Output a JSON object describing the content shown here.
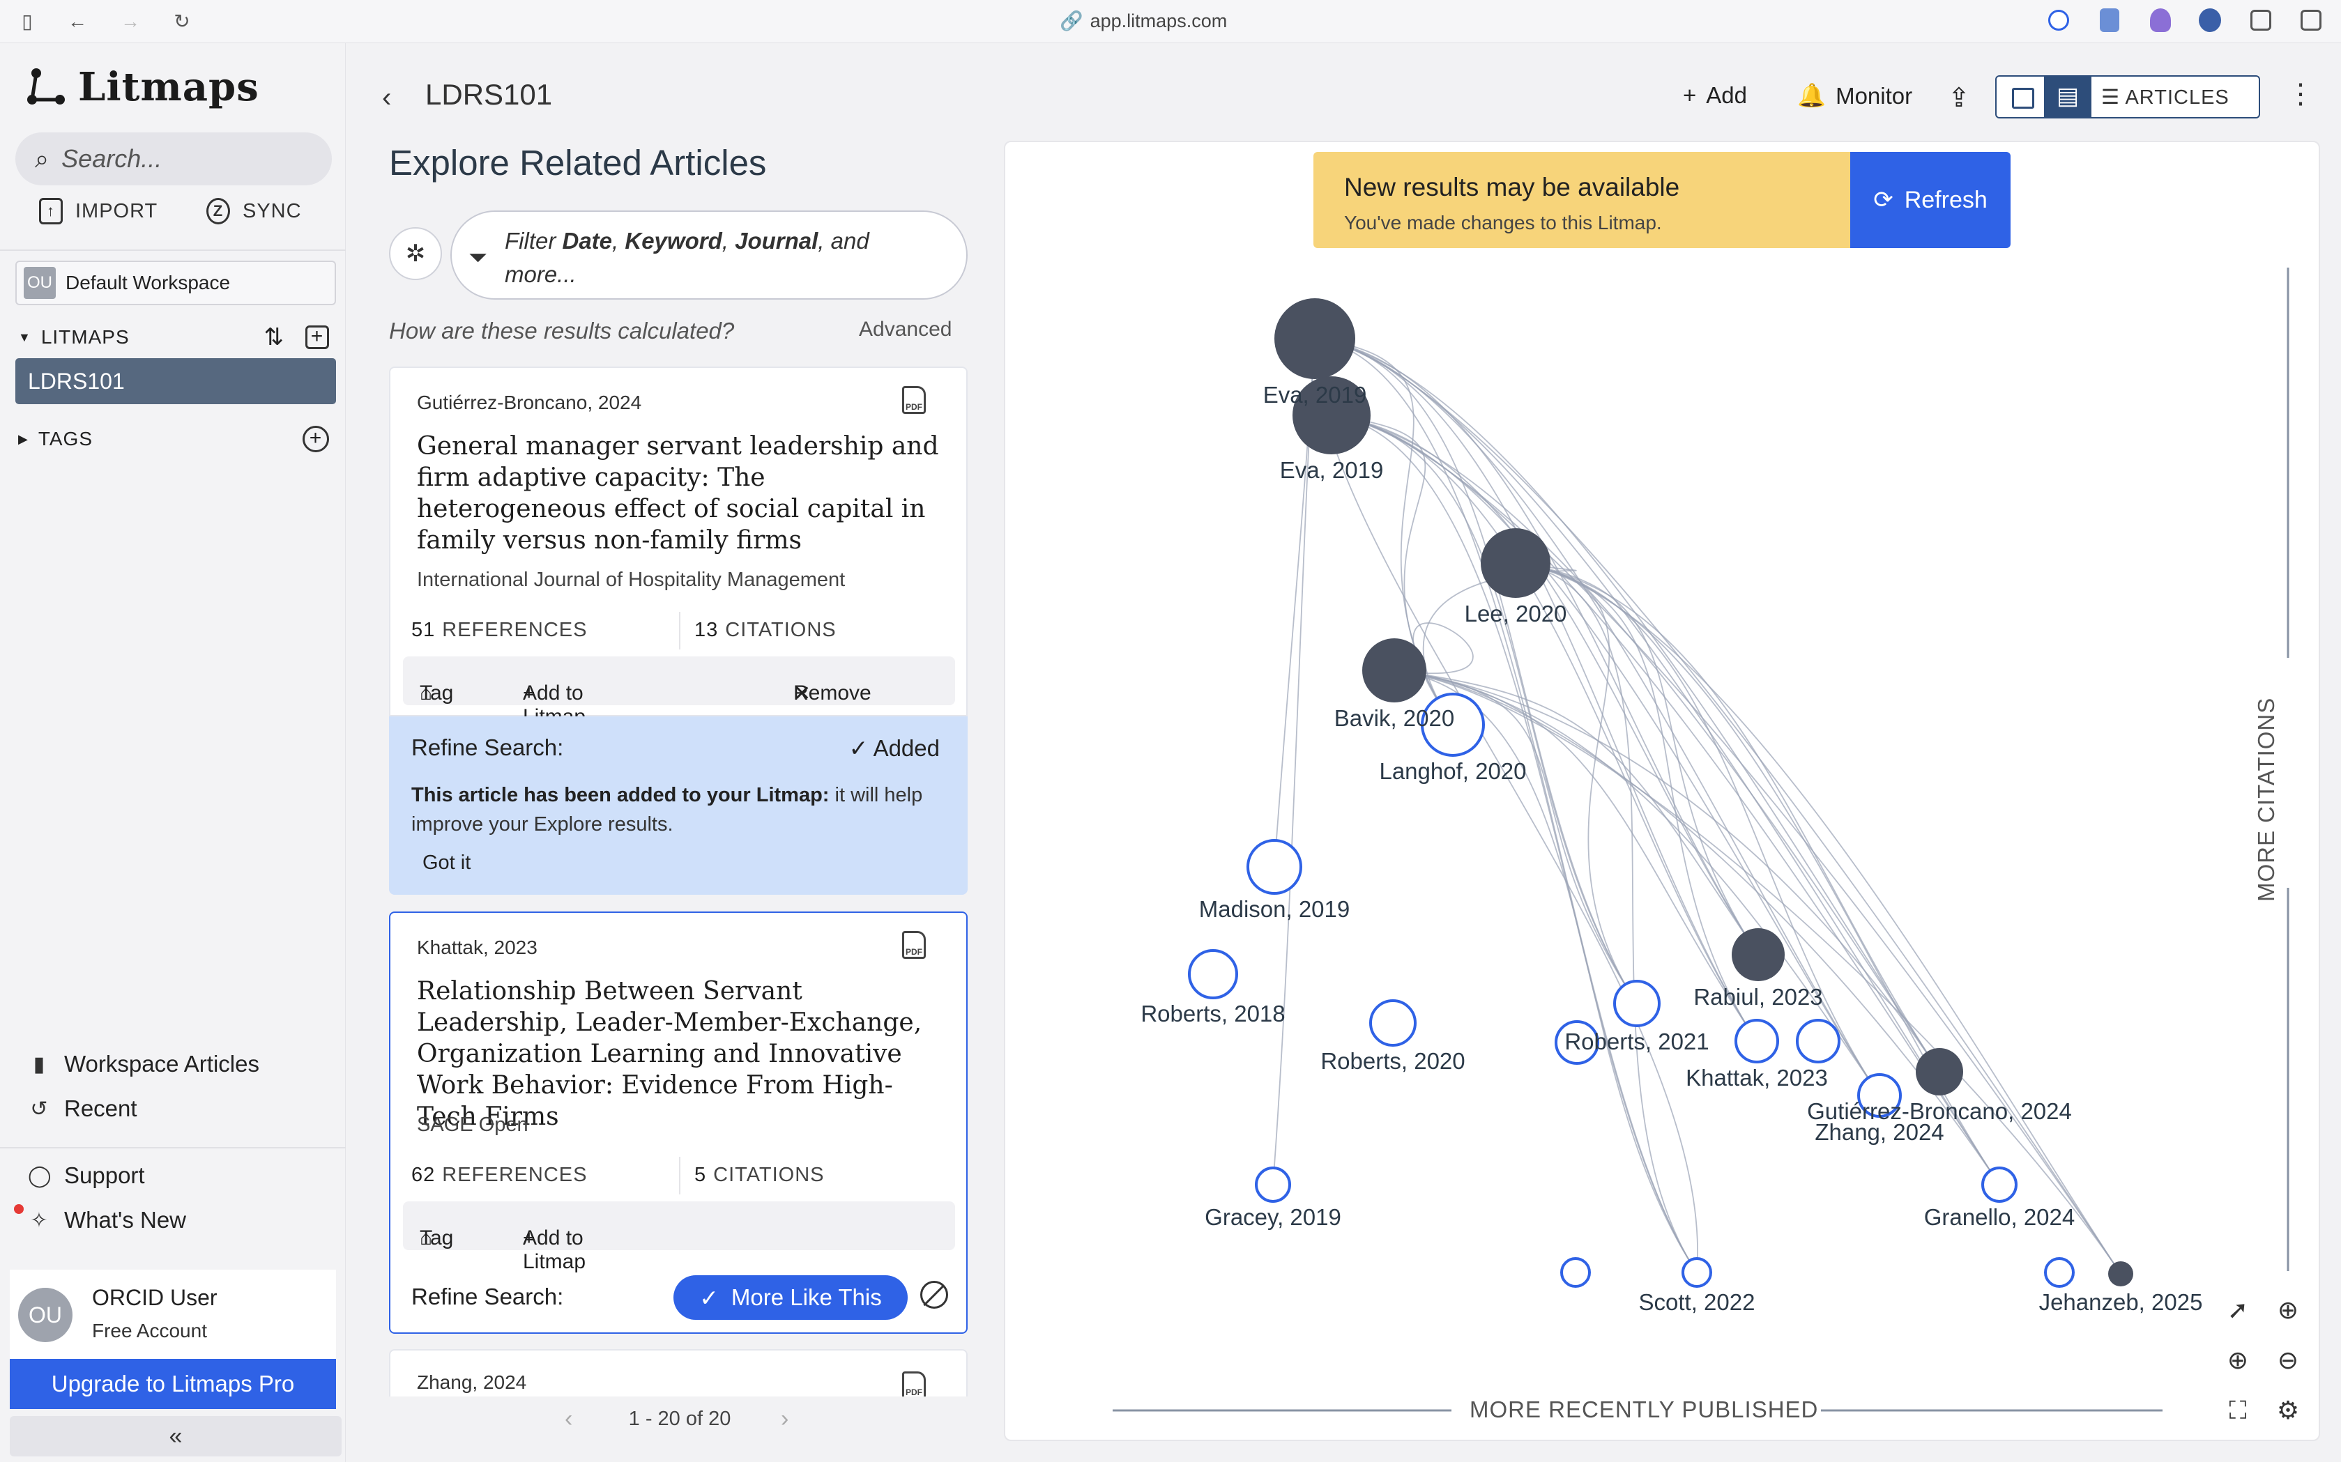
{
  "browser": {
    "url": "app.litmaps.com"
  },
  "sidebar": {
    "brand": "Litmaps",
    "search_placeholder": "Search...",
    "import_label": "IMPORT",
    "sync_label": "SYNC",
    "workspace_initials": "OU",
    "workspace_name": "Default Workspace",
    "litmaps_heading": "LITMAPS",
    "active_litmap": "LDRS101",
    "tags_heading": "TAGS",
    "workspace_articles": "Workspace Articles",
    "recent": "Recent",
    "support": "Support",
    "whats_new": "What's New",
    "user_initials": "OU",
    "user_name": "ORCID User",
    "user_tier": "Free Account",
    "upgrade_label": "Upgrade to Litmaps Pro"
  },
  "header": {
    "litmap_name": "LDRS101",
    "add_label": "Add",
    "monitor_label": "Monitor",
    "articles_label": "ARTICLES"
  },
  "explore": {
    "title": "Explore Related Articles",
    "filter_prefix": "Filter ",
    "filter_date": "Date",
    "filter_sep1": ", ",
    "filter_keyword": "Keyword",
    "filter_sep2": ", ",
    "filter_journal": "Journal",
    "filter_suffix": ", and more...",
    "how_text": "How are these results calculated?",
    "advanced_label": "Advanced"
  },
  "cards": [
    {
      "author": "Gutiérrez-Broncano, 2024",
      "pdf": "PDF",
      "title": "General manager servant leadership and firm adaptive capacity: The heterogeneous effect of social capital in family versus non-family firms",
      "journal": "International Journal of Hospitality Management",
      "references": "51",
      "citations": "13",
      "references_label": "REFERENCES",
      "citations_label": "CITATIONS",
      "tag_label": "Tag",
      "add_label": "Add to Litmap",
      "remove_label": "Remove"
    },
    {
      "author": "Khattak, 2023",
      "pdf": "PDF",
      "title": "Relationship Between Servant Leadership, Leader-Member-Exchange, Organization Learning and Innovative Work Behavior: Evidence From High-Tech Firms",
      "journal": "SAGE Open",
      "references": "62",
      "citations": "5",
      "references_label": "REFERENCES",
      "citations_label": "CITATIONS",
      "tag_label": "Tag",
      "add_label": "Add to Litmap"
    },
    {
      "author": "Zhang, 2024",
      "pdf": "PDF"
    }
  ],
  "refine1": {
    "title": "Refine Search:",
    "status": "Added",
    "desc_bold": "This article has been added to your Litmap:",
    "desc_rest": " it will help improve your Explore results.",
    "got_it": "Got it"
  },
  "refine2": {
    "title": "Refine Search:",
    "more_like_this": "More Like This"
  },
  "pager": {
    "range": "1 - 20 of 20"
  },
  "map": {
    "notice_title": "New results may be available",
    "notice_sub": "You've made changes to this Litmap.",
    "refresh_label": "Refresh",
    "x_axis_label": "MORE RECENTLY PUBLISHED",
    "y_axis_label": "MORE CITATIONS",
    "nodes": [
      {
        "label": "Eva, 2019",
        "filled": true
      },
      {
        "label": "Eva, 2019",
        "filled": true
      },
      {
        "label": "Lee, 2020",
        "filled": true
      },
      {
        "label": "Bavik, 2020",
        "filled": true
      },
      {
        "label": "Langhof, 2020",
        "filled": false
      },
      {
        "label": "Rabiul, 2023",
        "filled": true
      },
      {
        "label": "Madison, 2019",
        "filled": false
      },
      {
        "label": "Gutiérrez-Broncano, 2024",
        "filled": true
      },
      {
        "label": "Roberts, 2018",
        "filled": false
      },
      {
        "label": "Roberts, 2020",
        "filled": false
      },
      {
        "label": "Roberts, 2021",
        "filled": false
      },
      {
        "label": "Khattak, 2023",
        "filled": false
      },
      {
        "label": "Zhang, 2024",
        "filled": false
      },
      {
        "label": "Gracey, 2019",
        "filled": false
      },
      {
        "label": "Granello, 2024",
        "filled": false
      },
      {
        "label": "Scott, 2022",
        "filled": false
      },
      {
        "label": "Jehanzeb, 2025",
        "filled": true
      }
    ]
  },
  "colors": {
    "accent": "#2f62e6",
    "node_filled": "#4a5160",
    "notice": "#f7d47a",
    "active": "#56687f"
  }
}
